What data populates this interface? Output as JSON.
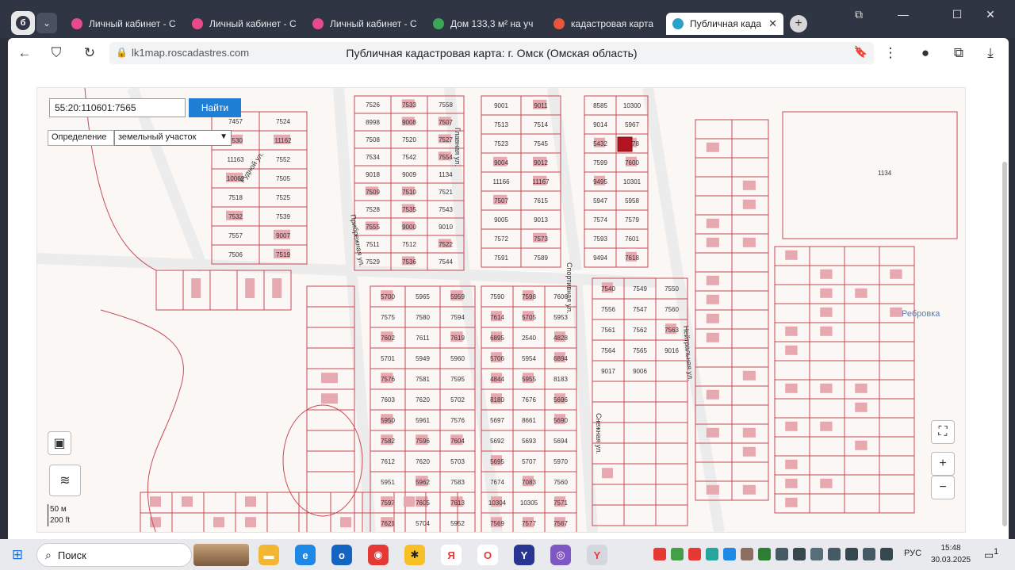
{
  "browser": {
    "tabs": [
      {
        "title": "Личный кабинет - С",
        "favicon_color": "#e94b8a"
      },
      {
        "title": "Личный кабинет - С",
        "favicon_color": "#e94b8a"
      },
      {
        "title": "Личный кабинет - С",
        "favicon_color": "#e94b8a"
      },
      {
        "title": "Дом 133,3 м² на уч",
        "favicon_color": "#3aa757"
      },
      {
        "title": "кадастровая карта",
        "favicon_color": "#e8553e"
      },
      {
        "title": "Публичная када",
        "favicon_color": "#2aa1c8"
      }
    ],
    "active_tab_index": 5,
    "url": "lk1map.roscadastres.com",
    "page_title": "Публичная кадастровая карта: г. Омск (Омская область)"
  },
  "map": {
    "search_value": "55:20:110601:7565",
    "search_button": "Найти",
    "mode_label": "Определение",
    "mode_value": "земельный участок",
    "scale": {
      "top": "50 м",
      "bottom": "200 ft"
    },
    "street_labels": [
      "Рудной ул.",
      "Прибрежная ул.",
      "Главная ул.",
      "Спортивная ул.",
      "Нейтральная ул.",
      "Снежная ул."
    ],
    "place_label": "Ребровка",
    "parcel_labels": [
      {
        "t": "7457"
      },
      {
        "t": "7524"
      },
      {
        "t": "7530"
      },
      {
        "t": "11162"
      },
      {
        "t": "11163"
      },
      {
        "t": "7552"
      },
      {
        "t": "10062"
      },
      {
        "t": "7505"
      },
      {
        "t": "7518"
      },
      {
        "t": "7525"
      },
      {
        "t": "7532"
      },
      {
        "t": "7539"
      },
      {
        "t": "7557"
      },
      {
        "t": "9007"
      },
      {
        "t": "7506"
      },
      {
        "t": "7519"
      },
      {
        "t": "7526"
      },
      {
        "t": "7533"
      },
      {
        "t": "7558"
      },
      {
        "t": "8998"
      },
      {
        "t": "9008"
      },
      {
        "t": "7507"
      },
      {
        "t": "7508"
      },
      {
        "t": "7520"
      },
      {
        "t": "7527"
      },
      {
        "t": "7534"
      },
      {
        "t": "7542"
      },
      {
        "t": "7554"
      },
      {
        "t": "9018"
      },
      {
        "t": "9009"
      },
      {
        "t": "1134"
      },
      {
        "t": "7509"
      },
      {
        "t": "7510"
      },
      {
        "t": "7521"
      },
      {
        "t": "7528"
      },
      {
        "t": "7535"
      },
      {
        "t": "7543"
      },
      {
        "t": "7555"
      },
      {
        "t": "9000"
      },
      {
        "t": "9010"
      },
      {
        "t": "7511"
      },
      {
        "t": "7512"
      },
      {
        "t": "7522"
      },
      {
        "t": "7529"
      },
      {
        "t": "7536"
      },
      {
        "t": "7544"
      },
      {
        "t": "9001"
      },
      {
        "t": "9011"
      },
      {
        "t": "7513"
      },
      {
        "t": "7514"
      },
      {
        "t": "7523"
      },
      {
        "t": "7545"
      },
      {
        "t": "9004"
      },
      {
        "t": "9012"
      },
      {
        "t": "11166"
      },
      {
        "t": "11167"
      },
      {
        "t": "7507"
      },
      {
        "t": "7615"
      },
      {
        "t": "9005"
      },
      {
        "t": "9013"
      },
      {
        "t": "7572"
      },
      {
        "t": "7573"
      },
      {
        "t": "7591"
      },
      {
        "t": "7589"
      },
      {
        "t": "8585"
      },
      {
        "t": "10300"
      },
      {
        "t": "9014"
      },
      {
        "t": "5967"
      },
      {
        "t": "5432"
      },
      {
        "t": "7578"
      },
      {
        "t": "7599"
      },
      {
        "t": "7600"
      },
      {
        "t": "9495"
      },
      {
        "t": "10301"
      },
      {
        "t": "5947"
      },
      {
        "t": "5958"
      },
      {
        "t": "7574"
      },
      {
        "t": "7579"
      },
      {
        "t": "7593"
      },
      {
        "t": "7601"
      },
      {
        "t": "9494"
      },
      {
        "t": "7618"
      },
      {
        "t": "5700"
      },
      {
        "t": "5965"
      },
      {
        "t": "5959"
      },
      {
        "t": "7575"
      },
      {
        "t": "7580"
      },
      {
        "t": "7594"
      },
      {
        "t": "7602"
      },
      {
        "t": "7611"
      },
      {
        "t": "7619"
      },
      {
        "t": "5701"
      },
      {
        "t": "5949"
      },
      {
        "t": "5960"
      },
      {
        "t": "7576"
      },
      {
        "t": "7581"
      },
      {
        "t": "7595"
      },
      {
        "t": "7603"
      },
      {
        "t": "7620"
      },
      {
        "t": "5702"
      },
      {
        "t": "5950"
      },
      {
        "t": "5961"
      },
      {
        "t": "7576"
      },
      {
        "t": "7582"
      },
      {
        "t": "7596"
      },
      {
        "t": "7604"
      },
      {
        "t": "7612"
      },
      {
        "t": "7620"
      },
      {
        "t": "5703"
      },
      {
        "t": "5951"
      },
      {
        "t": "5962"
      },
      {
        "t": "7583"
      },
      {
        "t": "7597"
      },
      {
        "t": "7605"
      },
      {
        "t": "7613"
      },
      {
        "t": "7621"
      },
      {
        "t": "5704"
      },
      {
        "t": "5952"
      },
      {
        "t": "7590"
      },
      {
        "t": "7598"
      },
      {
        "t": "7606"
      },
      {
        "t": "7614"
      },
      {
        "t": "5705"
      },
      {
        "t": "5953"
      },
      {
        "t": "6895"
      },
      {
        "t": "2540"
      },
      {
        "t": "4828"
      },
      {
        "t": "5706"
      },
      {
        "t": "5954"
      },
      {
        "t": "6894"
      },
      {
        "t": "4844"
      },
      {
        "t": "5955"
      },
      {
        "t": "8183"
      },
      {
        "t": "8180"
      },
      {
        "t": "7676"
      },
      {
        "t": "5696"
      },
      {
        "t": "5697"
      },
      {
        "t": "8661"
      },
      {
        "t": "5690"
      },
      {
        "t": "5692"
      },
      {
        "t": "5693"
      },
      {
        "t": "5694"
      },
      {
        "t": "5695"
      },
      {
        "t": "5707"
      },
      {
        "t": "5970"
      },
      {
        "t": "7674"
      },
      {
        "t": "7083"
      },
      {
        "t": "7560"
      },
      {
        "t": "10304"
      },
      {
        "t": "10305"
      },
      {
        "t": "7571"
      },
      {
        "t": "7569"
      },
      {
        "t": "7577"
      },
      {
        "t": "7567"
      },
      {
        "t": "7540"
      },
      {
        "t": "7549"
      },
      {
        "t": "7550"
      },
      {
        "t": "7556"
      },
      {
        "t": "7547"
      },
      {
        "t": "7560"
      },
      {
        "t": "7561"
      },
      {
        "t": "7562"
      },
      {
        "t": "7563"
      },
      {
        "t": "7564"
      },
      {
        "t": "7565"
      },
      {
        "t": "9016"
      },
      {
        "t": "9017"
      },
      {
        "t": "9006"
      }
    ]
  },
  "taskbar": {
    "search_label": "Поиск",
    "lang": "РУС",
    "time": "15:48",
    "date": "30.03.2025",
    "notif_count": "1"
  }
}
